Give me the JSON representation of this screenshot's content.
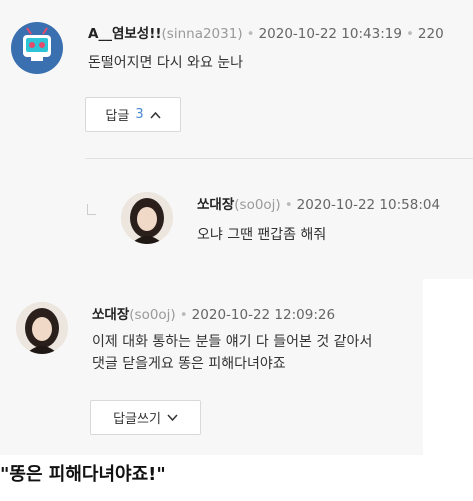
{
  "comment1": {
    "nickname": "A__염보성!!",
    "user_id": "(sinna2031)",
    "separator": "•",
    "timestamp": "2020-10-22 10:43:19",
    "extra": "220",
    "text": "돈떨어지면 다시 와요 눈나",
    "reply_button": {
      "label": "답글",
      "count": "3",
      "icon": "chevron-up-icon"
    }
  },
  "reply1": {
    "nickname": "쏘대장",
    "user_id": "(so0oj)",
    "separator": "•",
    "timestamp": "2020-10-22 10:58:04",
    "text": "오냐 그땐 팬갑좀 해줘"
  },
  "comment2": {
    "nickname": "쏘대장",
    "user_id": "(so0oj)",
    "separator": "•",
    "timestamp": "2020-10-22 12:09:26",
    "text_line1": "이제 대화 통하는 분들 얘기 다 들어본 것 같아서",
    "text_line2": "댓글 닫을게요 똥은 피해다녀야죠",
    "reply_button": {
      "label": "답글쓰기",
      "icon": "chevron-down-icon"
    }
  },
  "caption": "\"똥은 피해다녀야죠!\"",
  "colors": {
    "panel": "#f7f7f7",
    "accent_count": "#4a88d6",
    "avatar1_bg": "#3a6fb0"
  }
}
